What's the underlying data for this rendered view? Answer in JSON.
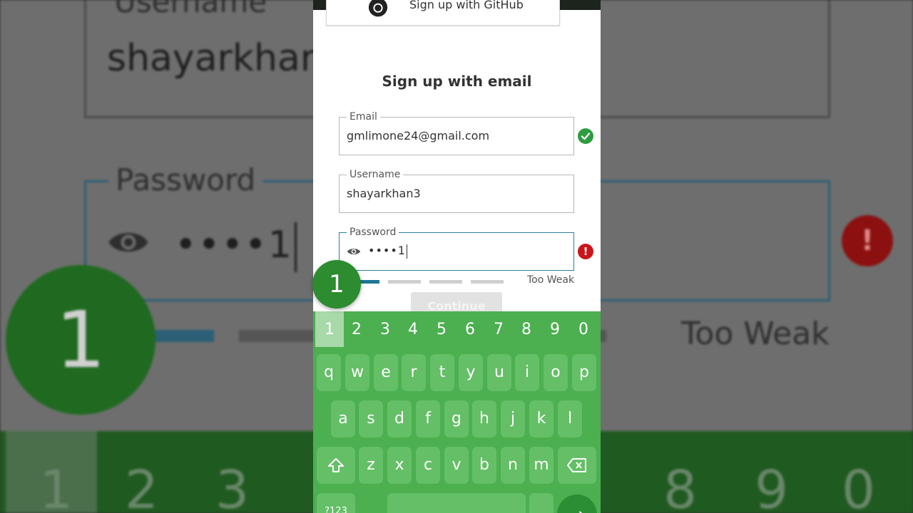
{
  "background": {
    "username_label": "Username",
    "username_value": "shayarkhan3",
    "password_label": "Password",
    "password_value": "••••1",
    "alert_glyph": "!",
    "badge_number": "1",
    "strength_text": "Too Weak",
    "digits": [
      "1",
      "2",
      "3",
      "4",
      "5",
      "6",
      "7",
      "8",
      "9",
      "0"
    ]
  },
  "signup": {
    "github_label": "Sign up with GitHub",
    "section_title": "Sign up with email",
    "email": {
      "label": "Email",
      "value": "gmlimone24@gmail.com",
      "status_icon": "check-circle-icon"
    },
    "username": {
      "label": "Username",
      "value": "shayarkhan3"
    },
    "password": {
      "label": "Password",
      "value": "••••1",
      "status_icon": "error-icon",
      "status_glyph": "!"
    },
    "strength": {
      "text": "Too Weak",
      "filled_segments": 1,
      "total_segments": 4
    },
    "continue_label": "Continue"
  },
  "keyboard": {
    "numbers": [
      "1",
      "2",
      "3",
      "4",
      "5",
      "6",
      "7",
      "8",
      "9",
      "0"
    ],
    "active_number": "1",
    "row1": [
      "q",
      "w",
      "e",
      "r",
      "t",
      "y",
      "u",
      "i",
      "o",
      "p"
    ],
    "row2": [
      "a",
      "s",
      "d",
      "f",
      "g",
      "h",
      "j",
      "k",
      "l"
    ],
    "row3": [
      "z",
      "x",
      "c",
      "v",
      "b",
      "n",
      "m"
    ],
    "symbols_label": "?123"
  },
  "overlay_badge": "1",
  "colors": {
    "keyboard_green": "#4caf50",
    "key_green": "#64bf66",
    "focus_blue": "#2a7da1",
    "ok_green": "#2e9d3f",
    "error_red": "#c9151b"
  }
}
